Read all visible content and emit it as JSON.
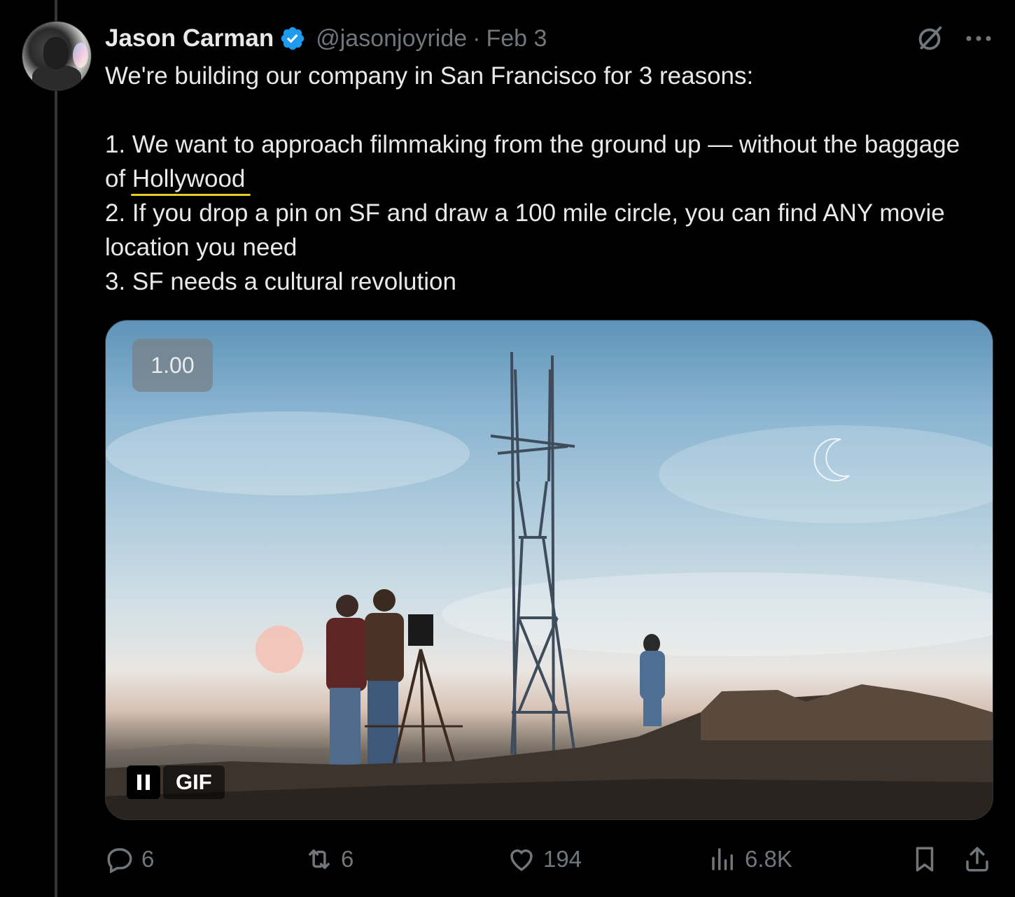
{
  "author": {
    "name": "Jason Carman",
    "handle": "@jasonjoyride",
    "separator": "·",
    "date": "Feb 3",
    "verified": true
  },
  "tweet": {
    "line_intro": "We're building our company in San Francisco for 3 reasons:",
    "reason1_a": "1. We want to approach filmmaking from the ground up — without the baggage of ",
    "reason1_highlight": "Hollywood",
    "reason2": "2. If you drop a pin on SF and draw a 100 mile circle, you can find ANY movie location you need",
    "reason3": "3. SF needs a cultural revolution"
  },
  "media": {
    "speed_badge": "1.00",
    "gif_label": "GIF",
    "type": "gif",
    "playing": true
  },
  "actions": {
    "replies": "6",
    "reposts": "6",
    "likes": "194",
    "views": "6.8K"
  },
  "icons": {
    "verified": "verified-badge-icon",
    "grok": "grok-icon",
    "more": "more-options-icon",
    "reply": "reply-icon",
    "repost": "repost-icon",
    "like": "heart-icon",
    "views": "views-icon",
    "bookmark": "bookmark-icon",
    "share": "share-icon"
  },
  "colors": {
    "background": "#000000",
    "text": "#e7e9ea",
    "muted": "#71767b",
    "verified_blue": "#1d9bf0",
    "highlight_underline": "#e3cf1e"
  }
}
